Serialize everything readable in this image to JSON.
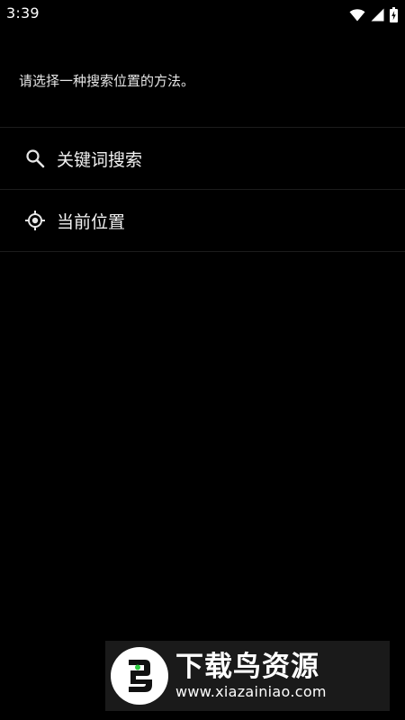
{
  "status_bar": {
    "time": "3:39",
    "icons": [
      "wifi-icon",
      "cellular-signal-icon",
      "battery-charging-icon"
    ]
  },
  "prompt": "请选择一种搜索位置的方法。",
  "options": [
    {
      "label": "关键词搜索",
      "icon": "search-icon"
    },
    {
      "label": "当前位置",
      "icon": "my-location-icon"
    }
  ],
  "watermark": {
    "title": "下载鸟资源",
    "url": "www.xiazainiao.com"
  },
  "colors": {
    "background": "#000000",
    "text": "#ffffff",
    "divider": "#1c1c1c",
    "watermark_bg": "#1a1a1a",
    "logo_green": "#2ecc40"
  }
}
